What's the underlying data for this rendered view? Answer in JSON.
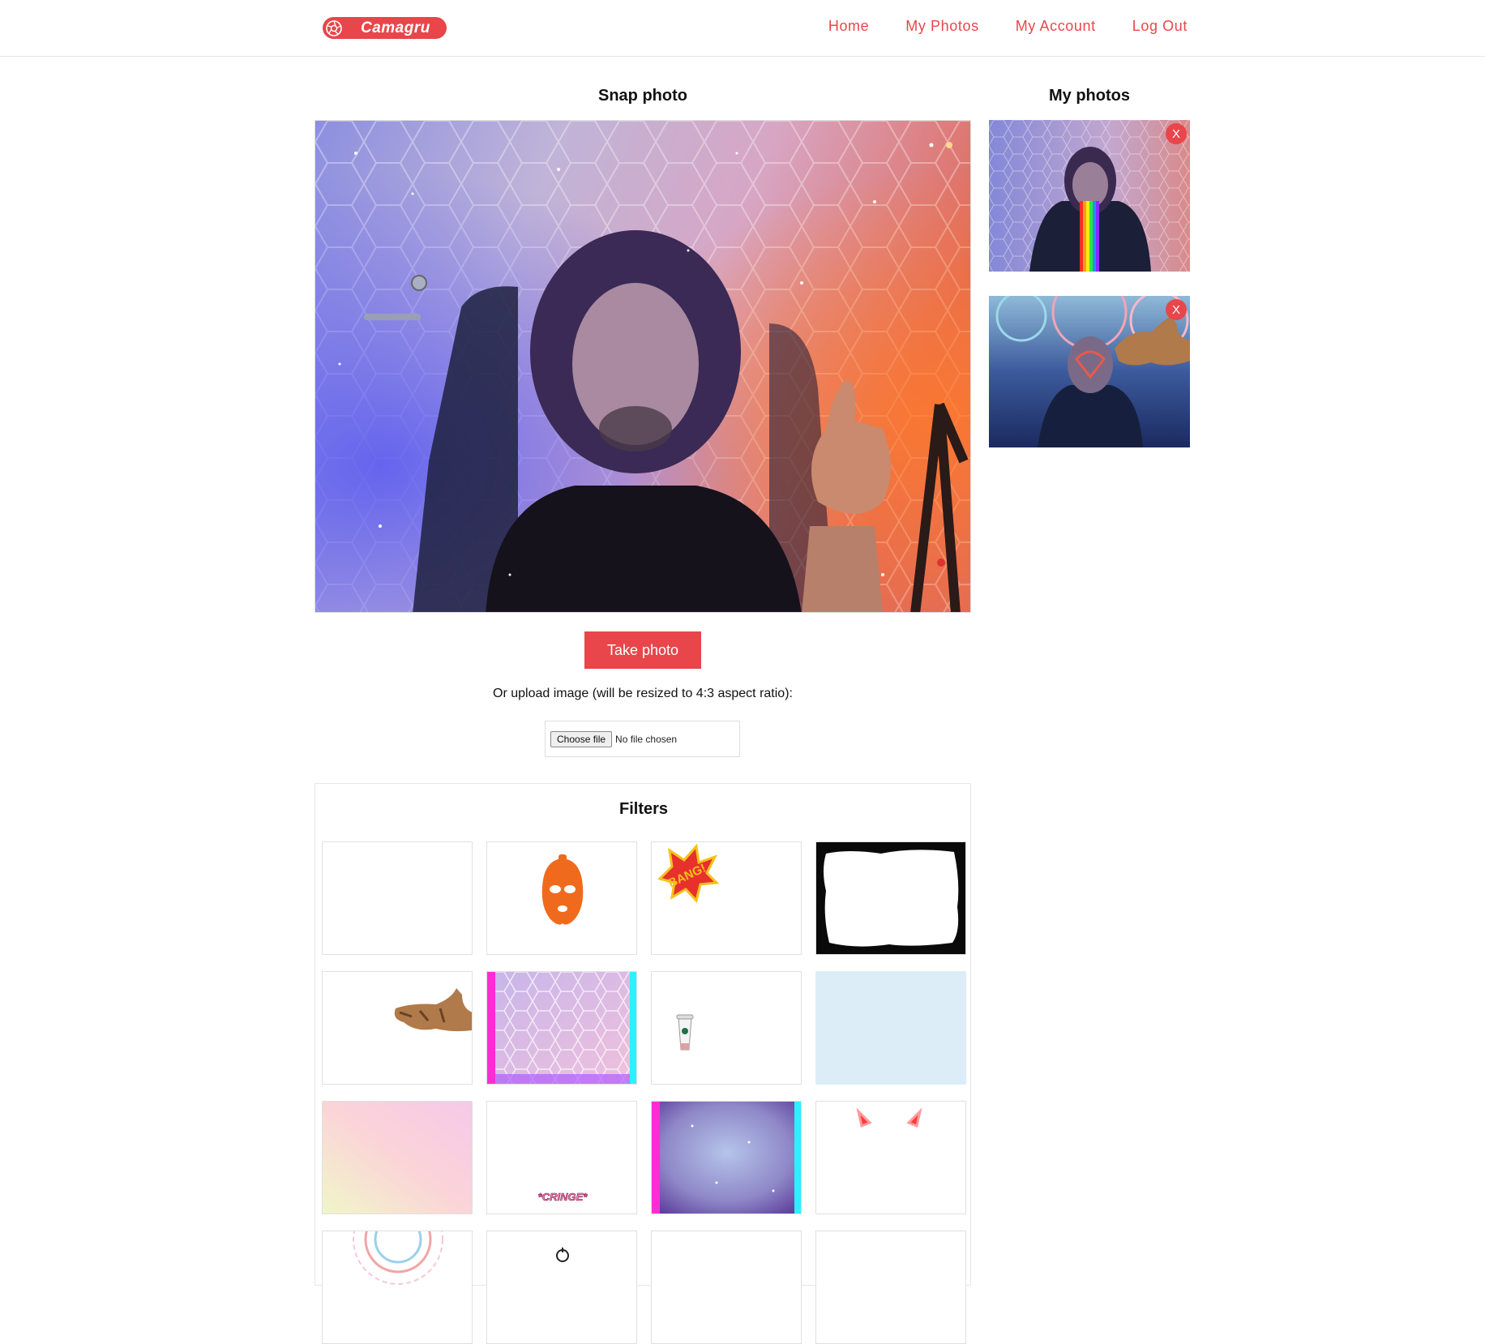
{
  "app": {
    "name": "Camagru"
  },
  "nav": {
    "home": "Home",
    "my_photos": "My Photos",
    "my_account": "My Account",
    "log_out": "Log Out"
  },
  "snap": {
    "title": "Snap photo",
    "take_photo": "Take photo",
    "upload_label": "Or upload image (will be resized to 4:3 aspect ratio):",
    "file_button": "Choose file",
    "file_status": "No file chosen"
  },
  "filters": {
    "title": "Filters",
    "items": [
      "none",
      "orange-ski-mask",
      "bang-sticker",
      "black-grunge-frame",
      "flying-cat",
      "pink-hexagon-neon",
      "coffee-cup",
      "light-blue-tint",
      "pastel-gradient",
      "cringe-text",
      "galaxy-neon",
      "glowing-eyes",
      "mandala",
      "bicycle",
      "blank",
      "blank"
    ],
    "cringe_text": "*CRINGE*",
    "bang_text": "BANG!"
  },
  "sidebar": {
    "title": "My photos",
    "delete_label": "X"
  },
  "colors": {
    "accent": "#e8464a"
  }
}
